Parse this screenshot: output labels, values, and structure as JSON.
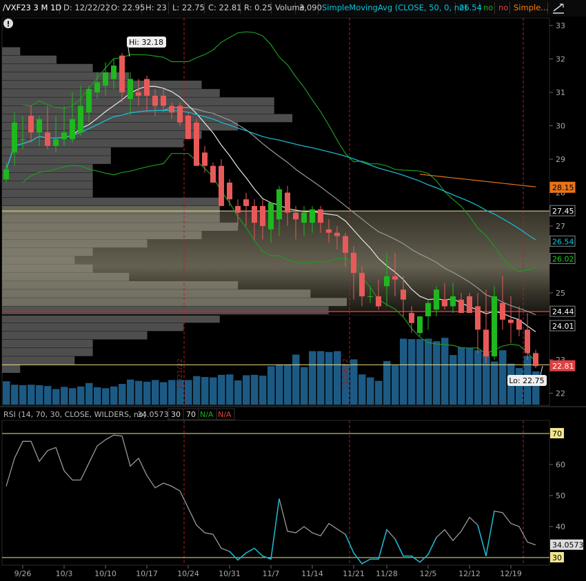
{
  "header": {
    "symbol": "/VXF23 3 M 1D",
    "date": "D: 12/22/22",
    "open": "O: 22.95",
    "high": "H: 23",
    "low": "L: 22.75",
    "close": "C: 22.81",
    "range": "R: 0.25",
    "volume_label": "Volume",
    "volume_value": "3,090",
    "sma50_label": "SimpleMovingAvg (CLOSE, 50, 0, no)",
    "sma50_value": "26.54",
    "sma50_flag1": "no",
    "sma50_flag2": "no",
    "sma_next_label": "Simple...",
    "colors": {
      "sma50": "#00bcd4",
      "green": "#1db01d",
      "red": "#e04040",
      "orange": "#ff7f00"
    }
  },
  "price_panel": {
    "hi_label": "Hi: 32.18",
    "lo_label": "Lo: 22.75",
    "badges": [
      {
        "text": "28.15",
        "price": 28.15,
        "bg": "#e8731a",
        "fg": "#000000"
      },
      {
        "text": "27.45",
        "price": 27.45,
        "bg": "#000000",
        "fg": "#ffffff",
        "border": "#888888"
      },
      {
        "text": "26.54",
        "price": 26.54,
        "bg": "#000000",
        "fg": "#00d0e8",
        "border": "#888888"
      },
      {
        "text": "26.02",
        "price": 26.02,
        "bg": "#000000",
        "fg": "#1dd01d",
        "border": "#888888"
      },
      {
        "text": "24.44",
        "price": 24.44,
        "bg": "#000000",
        "fg": "#ffffff",
        "border": "#888888"
      },
      {
        "text": "24.01",
        "price": 24.01,
        "bg": "#000000",
        "fg": "#ffffff",
        "border": "#888888"
      },
      {
        "text": "22.81",
        "price": 22.81,
        "bg": "#e04040",
        "fg": "#ffffff"
      }
    ],
    "marker_labels": [
      "10/21/22",
      "11/18/22"
    ]
  },
  "rsi_panel": {
    "label": "RSI (14, 70, 30, CLOSE, WILDERS, no)",
    "value": "34.0573",
    "ob": "30",
    "os": "70",
    "na1": "N/A",
    "na2": "N/A",
    "badges": [
      {
        "text": "70",
        "value": 70,
        "bg": "#f0e68c",
        "fg": "#000000"
      },
      {
        "text": "34.0573",
        "value": 34.0573,
        "bg": "#dddddd",
        "fg": "#000000"
      },
      {
        "text": "30",
        "value": 30,
        "bg": "#f0e68c",
        "fg": "#000000"
      }
    ]
  },
  "chart_data": [
    {
      "type": "candlestick",
      "title": "/VXF23 3 M 1D",
      "x": [
        "9/22",
        "9/23",
        "9/26",
        "9/27",
        "9/28",
        "9/29",
        "9/30",
        "10/3",
        "10/4",
        "10/5",
        "10/6",
        "10/7",
        "10/10",
        "10/11",
        "10/12",
        "10/13",
        "10/14",
        "10/17",
        "10/18",
        "10/19",
        "10/20",
        "10/21",
        "10/24",
        "10/25",
        "10/26",
        "10/27",
        "10/28",
        "10/31",
        "11/1",
        "11/2",
        "11/3",
        "11/4",
        "11/7",
        "11/8",
        "11/9",
        "11/10",
        "11/11",
        "11/14",
        "11/15",
        "11/16",
        "11/17",
        "11/18",
        "11/21",
        "11/22",
        "11/23",
        "11/25",
        "11/28",
        "11/29",
        "11/30",
        "12/1",
        "12/2",
        "12/5",
        "12/6",
        "12/7",
        "12/8",
        "12/9",
        "12/12",
        "12/13",
        "12/14",
        "12/15",
        "12/16",
        "12/19",
        "12/20",
        "12/21",
        "12/22"
      ],
      "open": [
        28.4,
        29.2,
        29.6,
        30.3,
        29.8,
        29.8,
        29.4,
        29.6,
        29.6,
        29.8,
        30.4,
        31.0,
        31.2,
        31.4,
        32.1,
        30.8,
        31.0,
        31.4,
        30.9,
        30.9,
        30.6,
        30.6,
        30.3,
        30.1,
        29.2,
        28.8,
        28.8,
        28.3,
        27.6,
        27.8,
        27.6,
        27.6,
        26.9,
        27.2,
        28.0,
        27.4,
        27.1,
        27.1,
        27.5,
        26.9,
        26.8,
        26.7,
        26.2,
        25.6,
        24.9,
        24.9,
        25.2,
        25.5,
        25.1,
        24.4,
        23.8,
        24.3,
        24.5,
        24.8,
        24.6,
        24.8,
        24.9,
        24.6,
        23.9,
        23.1,
        24.7,
        24.2,
        24.2,
        23.9,
        23.2
      ],
      "high": [
        28.9,
        30.4,
        30.3,
        30.6,
        30.3,
        30.6,
        30.3,
        30.6,
        31.0,
        31.2,
        31.2,
        31.6,
        31.9,
        32.0,
        32.18,
        31.6,
        31.4,
        31.5,
        31.1,
        31.1,
        30.7,
        30.7,
        30.4,
        30.2,
        29.4,
        28.9,
        29.0,
        28.4,
        27.8,
        28.0,
        27.8,
        27.8,
        27.4,
        28.2,
        28.2,
        27.6,
        27.6,
        27.6,
        27.6,
        27.2,
        27.0,
        26.8,
        26.4,
        25.8,
        25.2,
        25.4,
        26.2,
        26.2,
        25.5,
        24.6,
        24.3,
        24.8,
        25.2,
        25.3,
        25.3,
        25.0,
        25.0,
        25.0,
        25.1,
        25.2,
        25.5,
        24.9,
        24.6,
        24.4,
        23.3
      ],
      "low": [
        28.3,
        28.8,
        29.3,
        29.5,
        29.4,
        29.3,
        29.2,
        29.4,
        29.5,
        29.7,
        30.1,
        30.8,
        30.9,
        31.1,
        30.7,
        30.3,
        30.6,
        30.4,
        30.3,
        30.4,
        30.2,
        30.0,
        29.8,
        29.0,
        28.6,
        28.4,
        27.8,
        27.6,
        27.0,
        27.0,
        26.6,
        26.6,
        26.5,
        26.7,
        27.0,
        26.6,
        26.7,
        26.8,
        26.8,
        26.5,
        26.3,
        25.8,
        24.8,
        24.6,
        24.7,
        24.5,
        24.6,
        24.9,
        24.3,
        23.8,
        23.7,
        23.9,
        24.3,
        24.5,
        24.4,
        24.5,
        24.6,
        23.2,
        22.9,
        23.0,
        23.9,
        23.5,
        23.7,
        23.0,
        22.75
      ],
      "close": [
        28.7,
        30.1,
        29.6,
        29.8,
        30.2,
        29.4,
        29.6,
        29.8,
        30.2,
        30.6,
        31.1,
        31.3,
        31.6,
        31.8,
        31.0,
        31.4,
        30.9,
        30.9,
        30.6,
        30.6,
        30.4,
        30.1,
        29.6,
        28.8,
        28.8,
        28.3,
        27.6,
        27.8,
        27.4,
        27.6,
        27.1,
        27.0,
        27.7,
        28.1,
        27.4,
        27.2,
        27.4,
        27.5,
        27.1,
        26.8,
        26.7,
        26.2,
        25.6,
        24.9,
        24.9,
        24.6,
        25.5,
        25.4,
        24.8,
        24.1,
        24.3,
        24.7,
        25.1,
        24.6,
        24.9,
        24.4,
        24.4,
        23.9,
        23.1,
        24.9,
        24.2,
        24.1,
        23.9,
        23.2,
        22.81
      ]
    },
    {
      "type": "line",
      "ylabel": "RSI",
      "x": [
        "9/22",
        "9/23",
        "9/26",
        "9/27",
        "9/28",
        "9/29",
        "9/30",
        "10/3",
        "10/4",
        "10/5",
        "10/6",
        "10/7",
        "10/10",
        "10/11",
        "10/12",
        "10/13",
        "10/14",
        "10/17",
        "10/18",
        "10/19",
        "10/20",
        "10/21",
        "10/24",
        "10/25",
        "10/26",
        "10/27",
        "10/28",
        "10/31",
        "11/1",
        "11/2",
        "11/3",
        "11/4",
        "11/7",
        "11/8",
        "11/9",
        "11/10",
        "11/11",
        "11/14",
        "11/15",
        "11/16",
        "11/17",
        "11/18",
        "11/21",
        "11/22",
        "11/23",
        "11/25",
        "11/28",
        "11/29",
        "11/30",
        "12/1",
        "12/2",
        "12/5",
        "12/6",
        "12/7",
        "12/8",
        "12/9",
        "12/12",
        "12/13",
        "12/14",
        "12/15",
        "12/16",
        "12/19",
        "12/20",
        "12/21",
        "12/22"
      ],
      "values": [
        53,
        62,
        67.5,
        67.5,
        61,
        64.5,
        65.5,
        58,
        55,
        55,
        60.5,
        66,
        68,
        69.5,
        69.2,
        59.5,
        62,
        56.5,
        52.5,
        54,
        53,
        51.5,
        46,
        40.5,
        38,
        37.5,
        33,
        32,
        29.2,
        31.5,
        33,
        30.5,
        29.5,
        49,
        38.5,
        38,
        40,
        38,
        37,
        41,
        39.2,
        37.5,
        31.5,
        28,
        29.5,
        29.5,
        39,
        36,
        30.5,
        30.5,
        28.5,
        31,
        36.5,
        39,
        35.5,
        38.5,
        43,
        40.5,
        30.5,
        45,
        44.5,
        41,
        40,
        35,
        34.06
      ],
      "ylim": [
        24,
        72
      ]
    }
  ],
  "volume": [
    2700,
    2300,
    2250,
    2300,
    2250,
    2150,
    1800,
    2050,
    1900,
    2100,
    2500,
    2000,
    1900,
    2100,
    2400,
    2900,
    2750,
    2650,
    2850,
    2600,
    2850,
    2850,
    2850,
    3300,
    3200,
    3150,
    3450,
    3500,
    2800,
    3400,
    3450,
    3350,
    4450,
    4600,
    4600,
    5800,
    4350,
    6200,
    6200,
    6100,
    6200,
    4650,
    5250,
    3500,
    3150,
    2750,
    5050,
    4550,
    7650,
    7600,
    7600,
    7650,
    7350,
    7750,
    5750,
    6650,
    6550,
    6300,
    5950,
    5000,
    6300,
    4750,
    4250,
    5650,
    3850
  ],
  "volume_max": 12000,
  "axes": {
    "price_ticks": [
      "33",
      "32",
      "31",
      "30",
      "29",
      "28",
      "27",
      "26",
      "25",
      "24",
      "23",
      "22"
    ],
    "rsi_ticks": [
      "60",
      "50",
      "40"
    ],
    "date_ticks": [
      {
        "label": "9/26",
        "idx": 2
      },
      {
        "label": "10/3",
        "idx": 7
      },
      {
        "label": "10/10",
        "idx": 12
      },
      {
        "label": "10/17",
        "idx": 17
      },
      {
        "label": "10/24",
        "idx": 22
      },
      {
        "label": "10/31",
        "idx": 27
      },
      {
        "label": "11/7",
        "idx": 32
      },
      {
        "label": "11/14",
        "idx": 37
      },
      {
        "label": "11/21",
        "idx": 42
      },
      {
        "label": "11/28",
        "idx": 46
      },
      {
        "label": "12/5",
        "idx": 51
      },
      {
        "label": "12/12",
        "idx": 56
      },
      {
        "label": "12/19",
        "idx": 61
      }
    ]
  }
}
